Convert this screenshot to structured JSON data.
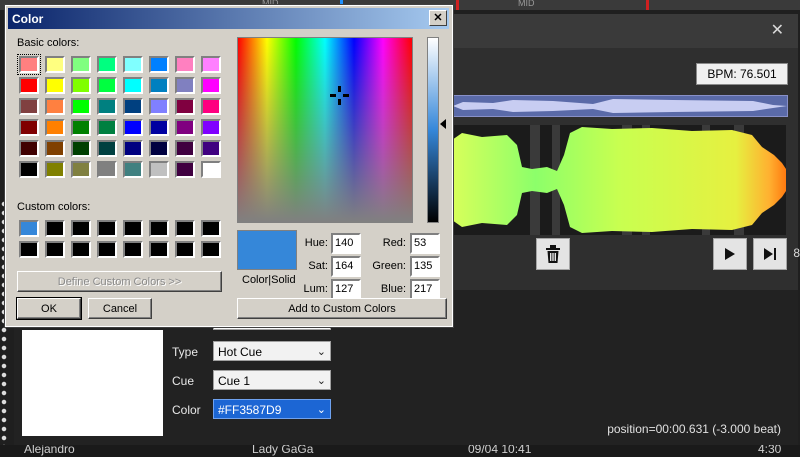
{
  "background": {
    "top_label_1": "MID",
    "top_label_2": "MID",
    "bpm": "BPM: 76.501",
    "side_number": "8",
    "position": "position=00:00.631 (-3.000 beat)",
    "fields": {
      "type_label": "Type",
      "type_value": "Hot Cue",
      "cue_label": "Cue",
      "cue_value": "Cue 1",
      "color_label": "Color",
      "color_value": "#FF3587D9"
    },
    "bottom_row": [
      "Alejandro",
      "Lady GaGa",
      "09/04 10:41",
      "4:30"
    ],
    "colors": {
      "accent_selected": "#1c66d4",
      "cue_color": "#3587d9"
    }
  },
  "dialog": {
    "title": "Color",
    "basic_colors_label": "Basic colors:",
    "custom_colors_label": "Custom colors:",
    "basic_colors": [
      "#ff8080",
      "#ffff80",
      "#80ff80",
      "#00ff80",
      "#80ffff",
      "#0080ff",
      "#ff80c0",
      "#ff80ff",
      "#ff0000",
      "#ffff00",
      "#80ff00",
      "#00ff40",
      "#00ffff",
      "#0080c0",
      "#8080c0",
      "#ff00ff",
      "#804040",
      "#ff8040",
      "#00ff00",
      "#008080",
      "#004080",
      "#8080ff",
      "#800040",
      "#ff0080",
      "#800000",
      "#ff8000",
      "#008000",
      "#008040",
      "#0000ff",
      "#0000a0",
      "#800080",
      "#8000ff",
      "#400000",
      "#804000",
      "#004000",
      "#004040",
      "#000080",
      "#000040",
      "#400040",
      "#400080",
      "#000000",
      "#808000",
      "#808040",
      "#808080",
      "#408080",
      "#c0c0c0",
      "#400040",
      "#ffffff"
    ],
    "custom_colors": [
      "#3587d9",
      "#000000",
      "#000000",
      "#000000",
      "#000000",
      "#000000",
      "#000000",
      "#000000",
      "#000000",
      "#000000",
      "#000000",
      "#000000",
      "#000000",
      "#000000",
      "#000000",
      "#000000"
    ],
    "define_custom_button": "Define Custom Colors >>",
    "ok_button": "OK",
    "cancel_button": "Cancel",
    "color_solid_label": "Color|Solid",
    "add_custom_button": "Add to Custom Colors",
    "hue_label": "Hue:",
    "hue": "140",
    "sat_label": "Sat:",
    "sat": "164",
    "lum_label": "Lum:",
    "lum": "127",
    "red_label": "Red:",
    "red": "53",
    "green_label": "Green:",
    "green": "135",
    "blue_label": "Blue:",
    "blue": "217",
    "preview_color": "#3587d9",
    "close_glyph": "✕",
    "close_icon": "close-icon"
  }
}
